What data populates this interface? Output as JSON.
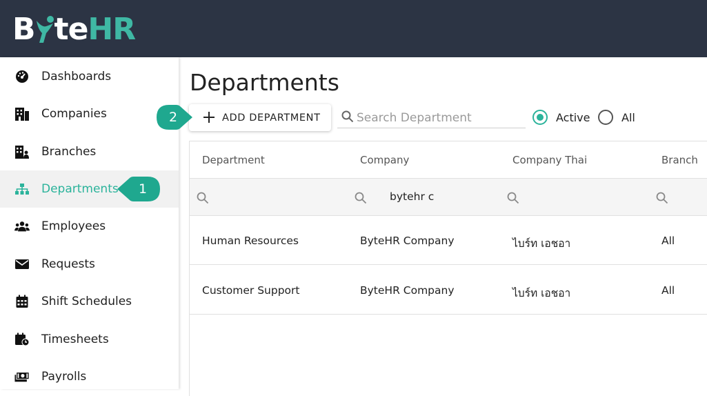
{
  "app": {
    "logo": {
      "part1": "B",
      "part2": "te",
      "part3": "HR",
      "colors": {
        "bar": "#2c3444",
        "accent": "#3fb8a4"
      }
    }
  },
  "sidebar": {
    "items": [
      {
        "label": "Dashboards",
        "icon": "speedometer-icon"
      },
      {
        "label": "Companies",
        "icon": "building-icon"
      },
      {
        "label": "Branches",
        "icon": "branch-building-icon"
      },
      {
        "label": "Departments",
        "icon": "sitemap-icon",
        "active": true
      },
      {
        "label": "Employees",
        "icon": "people-icon"
      },
      {
        "label": "Requests",
        "icon": "mail-icon"
      },
      {
        "label": "Shift Schedules",
        "icon": "calendar-icon"
      },
      {
        "label": "Timesheets",
        "icon": "calendar-clock-icon"
      },
      {
        "label": "Payrolls",
        "icon": "money-icon"
      }
    ]
  },
  "main": {
    "title": "Departments",
    "add_button": "ADD DEPARTMENT",
    "search": {
      "placeholder": "Search Department",
      "value": ""
    },
    "filters": [
      {
        "label": "Active",
        "checked": true
      },
      {
        "label": "All",
        "checked": false
      }
    ]
  },
  "table": {
    "columns": [
      "Department",
      "Company",
      "Company Thai",
      "Branch"
    ],
    "filter_values": [
      "",
      "bytehr c",
      "",
      ""
    ],
    "rows": [
      [
        "Human Resources",
        "ByteHR Company",
        "ไบร์ท เอชอา",
        "All"
      ],
      [
        "Customer Support",
        "ByteHR Company",
        "ไบร์ท เอชอา",
        "All"
      ]
    ]
  },
  "annotations": [
    {
      "number": "1",
      "color": "#1fa88f"
    },
    {
      "number": "2",
      "color": "#1fa88f"
    }
  ]
}
